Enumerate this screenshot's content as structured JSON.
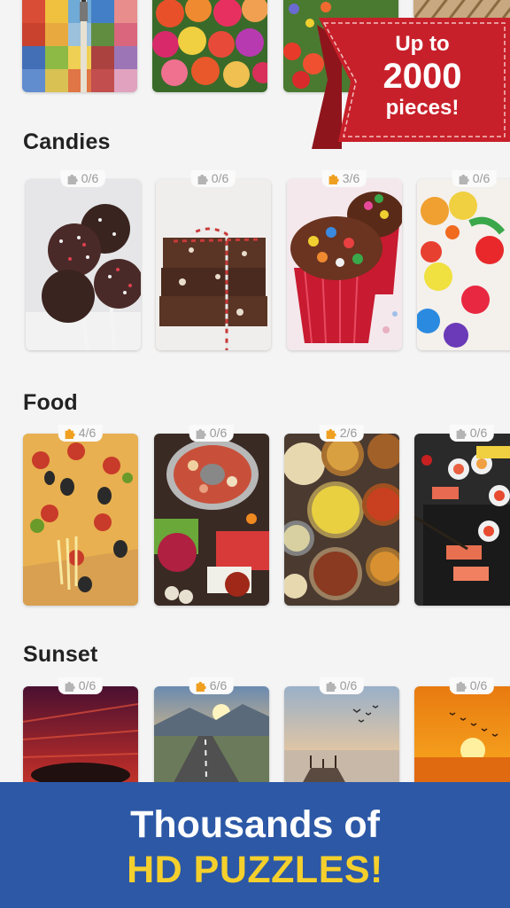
{
  "promo": {
    "line1": "Up to",
    "line2": "2000",
    "line3": "pieces!"
  },
  "sections": [
    {
      "title": "Candies",
      "cards": [
        {
          "progress": "0/6",
          "started": false,
          "image": "cake-pops"
        },
        {
          "progress": "0/6",
          "started": false,
          "image": "chocolate-fudge"
        },
        {
          "progress": "3/6",
          "started": true,
          "image": "cupcakes"
        },
        {
          "progress": "0/6",
          "started": false,
          "image": "gummy-candies"
        }
      ]
    },
    {
      "title": "Food",
      "cards": [
        {
          "progress": "4/6",
          "started": true,
          "image": "pizza"
        },
        {
          "progress": "0/6",
          "started": false,
          "image": "hot-pot"
        },
        {
          "progress": "2/6",
          "started": true,
          "image": "curry-dishes"
        },
        {
          "progress": "0/6",
          "started": false,
          "image": "sushi"
        }
      ]
    },
    {
      "title": "Sunset",
      "cards": [
        {
          "progress": "0/6",
          "started": false,
          "image": "red-sky"
        },
        {
          "progress": "6/6",
          "started": true,
          "image": "road-sunset"
        },
        {
          "progress": "0/6",
          "started": false,
          "image": "pier-sunset"
        },
        {
          "progress": "0/6",
          "started": false,
          "image": "orange-sun"
        }
      ]
    }
  ],
  "banner": {
    "line1": "Thousands of",
    "line2": "HD PUZZLES!"
  },
  "colors": {
    "accent_gold": "#f0a020",
    "badge_gray": "#b4b4b4",
    "banner_blue": "#2c58a6",
    "banner_yellow": "#f5d02c",
    "ribbon_red": "#c8202a"
  }
}
